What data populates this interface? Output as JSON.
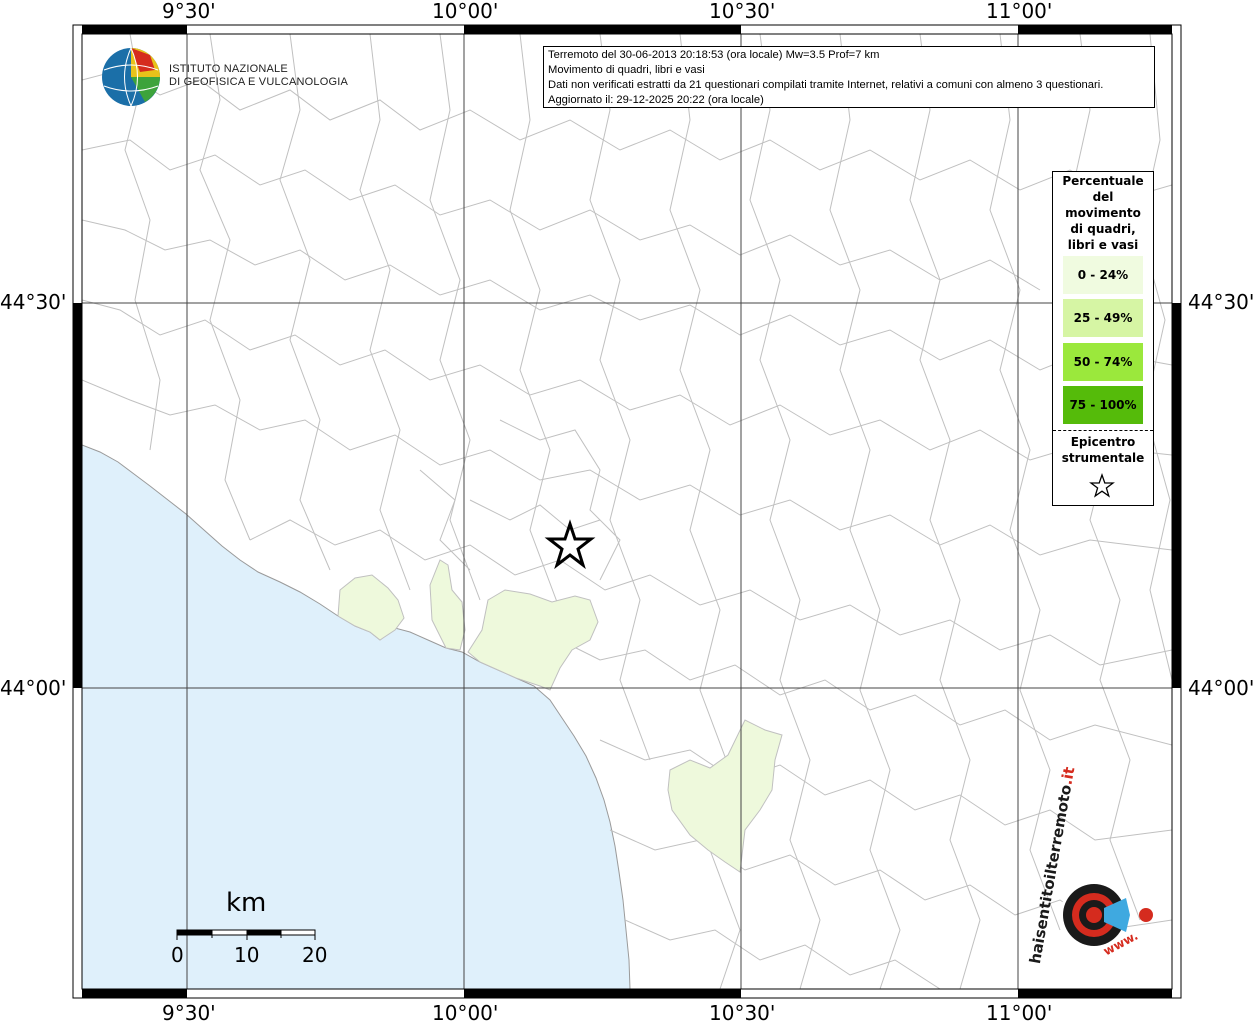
{
  "header": {
    "line1": "Terremoto del 30-06-2013 20:18:53 (ora locale) Mw=3.5 Prof=7 km",
    "line2": "Movimento di quadri, libri e vasi",
    "line3": "Dati non verificati estratti da 21 questionari compilati tramite Internet, relativi a comuni con almeno 3 questionari.",
    "line4": "Aggiornato il: 29-12-2025 20:22 (ora locale)"
  },
  "logo": {
    "line1": "ISTITUTO NAZIONALE",
    "line2": "DI GEOFISICA E VULCANOLOGIA"
  },
  "axes": {
    "top_labels": [
      "9°30'",
      "10°00'",
      "10°30'",
      "11°00'"
    ],
    "bottom_labels": [
      "9°30'",
      "10°00'",
      "10°30'",
      "11°00'"
    ],
    "left_labels": [
      "44°30'",
      "44°00'"
    ],
    "right_labels": [
      "44°30'",
      "44°00'"
    ]
  },
  "legend": {
    "title_lines": [
      "Percentuale",
      "del",
      "movimento",
      "di quadri,",
      "libri e vasi"
    ],
    "items": [
      {
        "label": "0 - 24%",
        "color": "#f0fbe0"
      },
      {
        "label": "25 - 49%",
        "color": "#d6f5a4"
      },
      {
        "label": "50 - 74%",
        "color": "#9be83c"
      },
      {
        "label": "75 - 100%",
        "color": "#55bb0a"
      }
    ],
    "epicenter_lines": [
      "Epicentro",
      "strumentale"
    ],
    "epicenter_icon": "star-icon"
  },
  "scalebar": {
    "unit": "km",
    "ticks": [
      "0",
      "10",
      "20"
    ]
  },
  "badge": {
    "text_main": "haisentitoilterremoto",
    "text_suffix": ".it",
    "text_www": "www.",
    "accent_color": "#d52b1e"
  },
  "colors": {
    "sea": "#dff0fb",
    "affected_municipality": "#eef9dc",
    "boundary": "#b8b8b8",
    "grid": "#555555"
  }
}
